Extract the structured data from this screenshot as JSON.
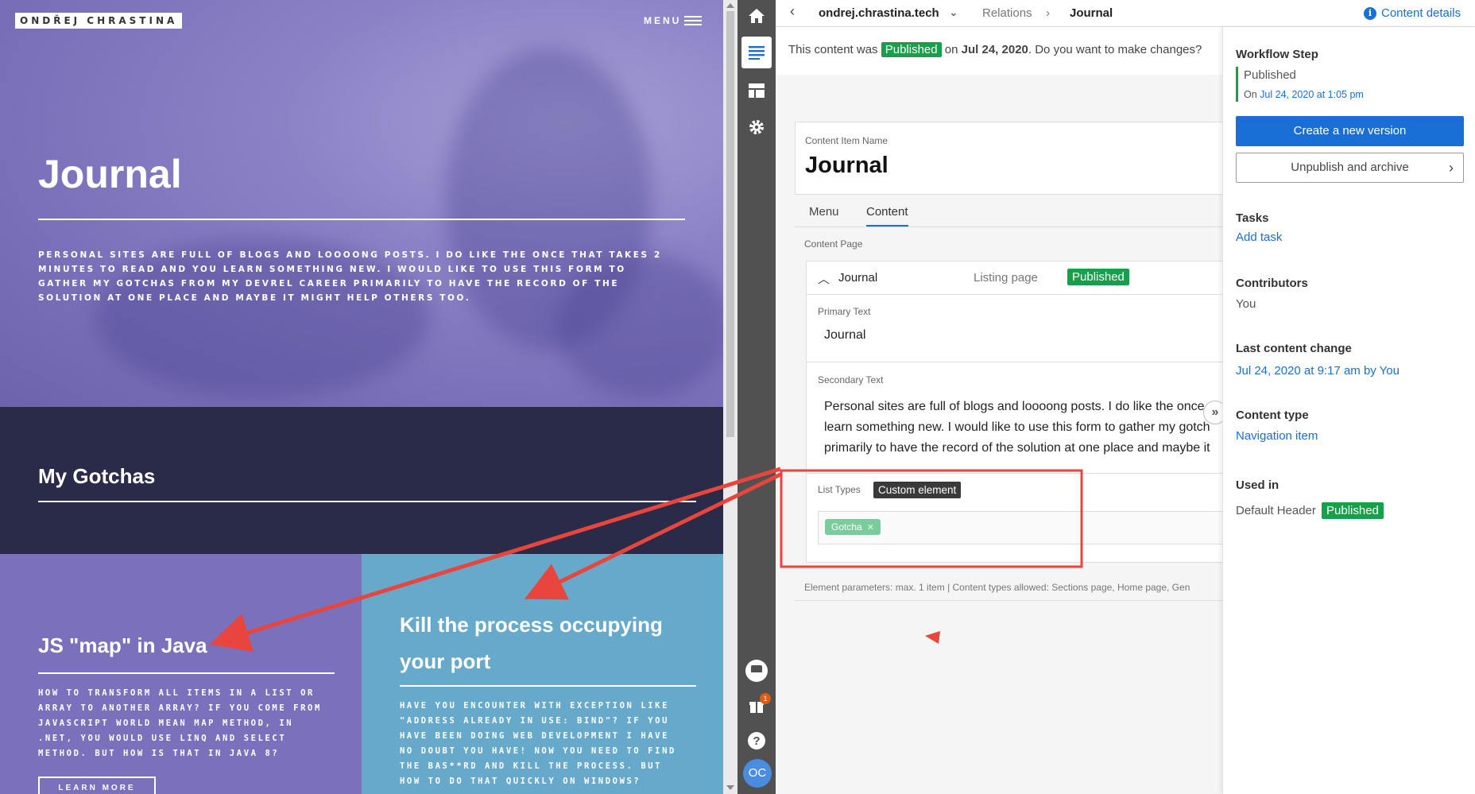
{
  "site": {
    "logo": "ONDŘEJ CHRASTINA",
    "menu": "MENU",
    "hero_title": "Journal",
    "hero_text": "Personal sites are full of blogs and loooong posts. I do like the once that takes 2 minutes to read and you learn something new. I would like to use this form to gather my gotchas from my devrel career primarily to have the record of the solution at one place and maybe it might help others too.",
    "section_title": "My Gotchas",
    "cards": [
      {
        "title": "JS \"map\" in Java",
        "text": "How to transform all items in a list or array  to another array? If you come from JavaScript world mean map method, in .NET, you would use LINQ and Select method. But how is that in Java 8?",
        "button": "LEARN MORE"
      },
      {
        "title": "Kill the process occupying your port",
        "text": "Have you encounter with exception like \"Address already in use: bind\"? If you have been doing web development I have no doubt you have! Now you need to find the bas**rd and kill the process. But how to do that quickly on Windows?"
      }
    ]
  },
  "rail": {
    "badge_count": "1",
    "avatar_initials": "OC"
  },
  "topbar": {
    "project": "ondrej.chrastina.tech",
    "relations": "Relations",
    "current": "Journal",
    "details": "Content details"
  },
  "notice": {
    "prefix": "This content was",
    "status": "Published",
    "on": "on",
    "date": "Jul 24, 2020",
    "suffix": ". Do you want to make changes?"
  },
  "editor": {
    "name_label": "Content Item Name",
    "name_value": "Journal",
    "tabs": [
      "Menu",
      "Content"
    ],
    "content_page_label": "Content Page",
    "page": {
      "name": "Journal",
      "type": "Listing page",
      "status": "Published"
    },
    "primary_label": "Primary Text",
    "primary_value": "Journal",
    "secondary_label": "Secondary Text",
    "secondary_lines": [
      "Personal sites are full of blogs and loooong posts. I do like the once",
      "learn something new. I would like to use this form to gather my gotch",
      "primarily to have the record of the solution at one place and maybe it"
    ],
    "list_types_label": "List Types",
    "tooltip": "Custom element",
    "chip": "Gotcha",
    "params": "Element parameters: max. 1 item | Content types allowed: Sections page, Home page, Gen"
  },
  "details": {
    "workflow_heading": "Workflow Step",
    "workflow_state": "Published",
    "workflow_date_prefix": "On",
    "workflow_date": "Jul 24, 2020 at 1:05 pm",
    "create_version": "Create a new version",
    "unpublish": "Unpublish and archive",
    "tasks_heading": "Tasks",
    "add_task": "Add task",
    "contributors_heading": "Contributors",
    "contributors": "You",
    "last_change_heading": "Last content change",
    "last_change": "Jul 24, 2020 at 9:17 am by You",
    "content_type_heading": "Content type",
    "content_type": "Navigation item",
    "used_in_heading": "Used in",
    "used_in": "Default Header",
    "used_in_status": "Published"
  },
  "colors": {
    "accent": "#1a6fd6",
    "published": "#17a04a",
    "annotation": "#e8453c"
  }
}
